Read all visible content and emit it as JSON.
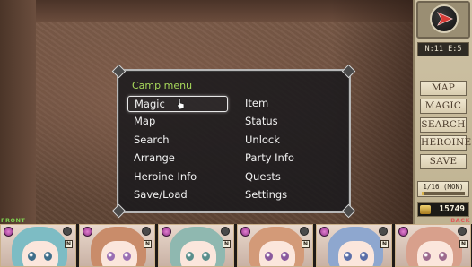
{
  "scene": {
    "description_icon": "dungeon-wall"
  },
  "camp_menu": {
    "title": "Camp menu",
    "items": [
      {
        "label": "Magic",
        "selected": true
      },
      {
        "label": "Item"
      },
      {
        "label": "Map"
      },
      {
        "label": "Status"
      },
      {
        "label": "Search"
      },
      {
        "label": "Unlock"
      },
      {
        "label": "Arrange"
      },
      {
        "label": "Party Info"
      },
      {
        "label": "Heroine Info"
      },
      {
        "label": "Quests"
      },
      {
        "label": "Save/Load"
      },
      {
        "label": "Settings"
      }
    ]
  },
  "side_panel": {
    "coords": "N:11 E:5",
    "compass_icon": "compass-arrow-east",
    "buttons": [
      "MAP",
      "MAGIC",
      "SEARCH",
      "HEROINE",
      "SAVE"
    ],
    "date": "1/16 (MON)",
    "gold": "15749"
  },
  "party": {
    "front_label": "FRONT",
    "back_label": "BACK",
    "members": [
      {
        "hair": "#7dbcc4",
        "eye": "#3f6e8a",
        "badge": "N"
      },
      {
        "hair": "#c98c6a",
        "eye": "#9a6fb3",
        "badge": "N"
      },
      {
        "hair": "#8fb8b0",
        "eye": "#5a8f8c",
        "badge": "N"
      },
      {
        "hair": "#d39a78",
        "eye": "#8a5a9e",
        "badge": "N"
      },
      {
        "hair": "#8ea7cf",
        "eye": "#5b6fa8",
        "badge": "N"
      },
      {
        "hair": "#d8a08c",
        "eye": "#9d6b8e",
        "badge": "N"
      }
    ]
  },
  "colors": {
    "menu_title": "#a8d95b",
    "front": "#7ecf4f",
    "back": "#e05a5a"
  }
}
